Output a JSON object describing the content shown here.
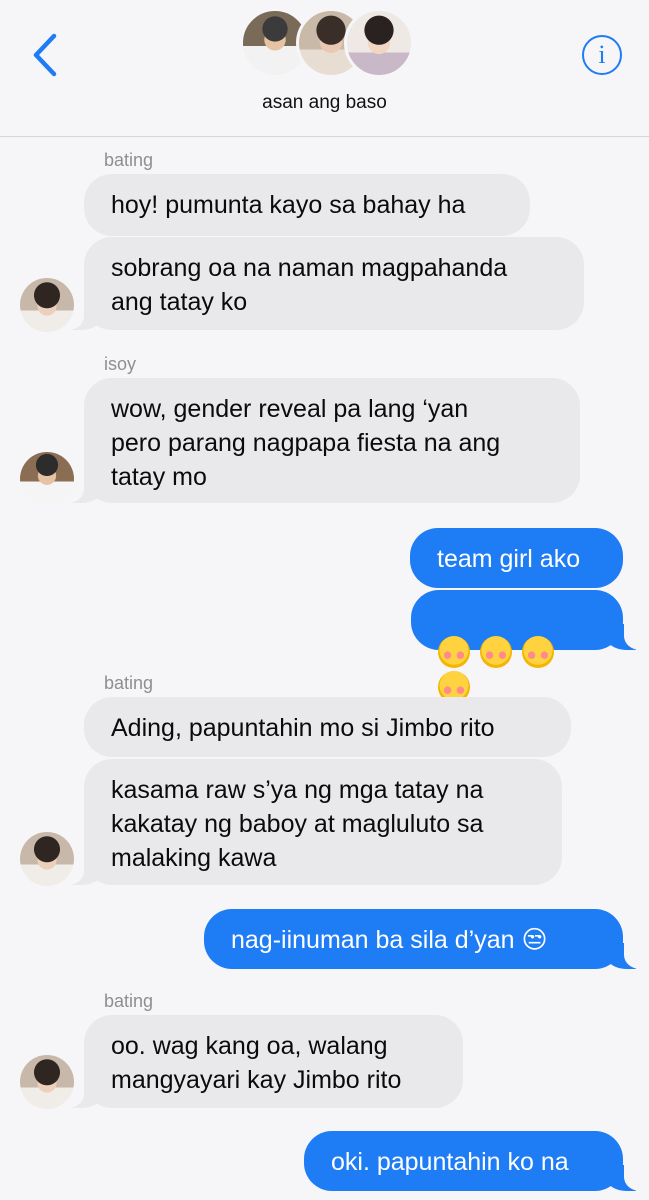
{
  "header": {
    "back_icon": "chevron-left-icon",
    "info_icon": "info-icon",
    "info_glyph": "i",
    "group_name": "asan ang baso",
    "accent": "#1e7cf5"
  },
  "messages": {
    "s1": "bating",
    "m1": "hoy! pumunta kayo sa bahay ha",
    "m2": "sobrang oa na naman magpahanda\nang tatay ko",
    "s2": "isoy",
    "m3": "wow, gender reveal pa lang ‘yan\npero parang nagpapa fiesta na ang\ntatay mo",
    "m4": "team girl ako",
    "m5": "🥰🥰🥰🥰",
    "s3": "bating",
    "m6": "Ading, papuntahin mo si Jimbo rito",
    "m7": "kasama raw s’ya ng mga tatay na\nkakatay ng baboy at magluluto sa\nmalaking kawa",
    "m8": "nag-iinuman ba sila d’yan 😒",
    "s4": "bating",
    "m9": "oo. wag kang oa, walang\nmangyayari kay Jimbo rito",
    "m10": "oki. papuntahin ko na"
  },
  "colors": {
    "incoming_bubble": "#e9e9eb",
    "outgoing_bubble": "#1e7cf5",
    "background": "#f6f6f8"
  }
}
